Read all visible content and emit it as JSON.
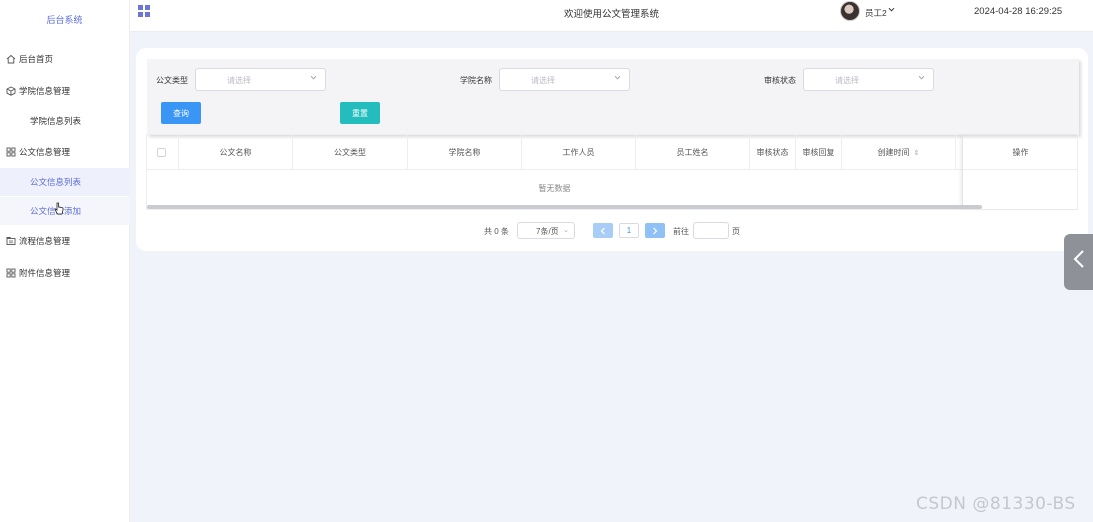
{
  "sidebar": {
    "brand": "后台系统",
    "items": [
      {
        "label": "后台首页",
        "icon": "home-icon"
      },
      {
        "label": "学院信息管理",
        "icon": "cube-icon"
      },
      {
        "label": "学院信息列表"
      },
      {
        "label": "公文信息管理",
        "icon": "grid-icon"
      },
      {
        "label": "公文信息列表",
        "state": "active"
      },
      {
        "label": "公文信息添加",
        "state": "hover"
      },
      {
        "label": "流程信息管理",
        "icon": "folder-icon"
      },
      {
        "label": "附件信息管理",
        "icon": "grid-icon"
      }
    ]
  },
  "topbar": {
    "title": "欢迎使用公文管理系统",
    "user": "员工2",
    "datetime": "2024-04-28 16:29:25"
  },
  "search": {
    "fields": [
      {
        "label": "公文类型",
        "placeholder": "请选择"
      },
      {
        "label": "学院名称",
        "placeholder": "请选择"
      },
      {
        "label": "审核状态",
        "placeholder": "请选择"
      }
    ],
    "query_label": "查询",
    "reset_label": "重置"
  },
  "table": {
    "columns": [
      "公文名称",
      "公文类型",
      "学院名称",
      "工作人员",
      "员工姓名",
      "审核状态",
      "审核回复",
      "创建时间",
      "操作"
    ],
    "empty_text": "暂无数据"
  },
  "pagination": {
    "total": "共 0 条",
    "page_size": "7条/页",
    "current_page": "1",
    "goto_label": "前往",
    "unit_label": "页"
  },
  "watermark": "CSDN @81330-BS",
  "colors": {
    "accent": "#5a6cd9",
    "primary_button": "#3a96f5",
    "reset_button": "#23bdbd"
  }
}
